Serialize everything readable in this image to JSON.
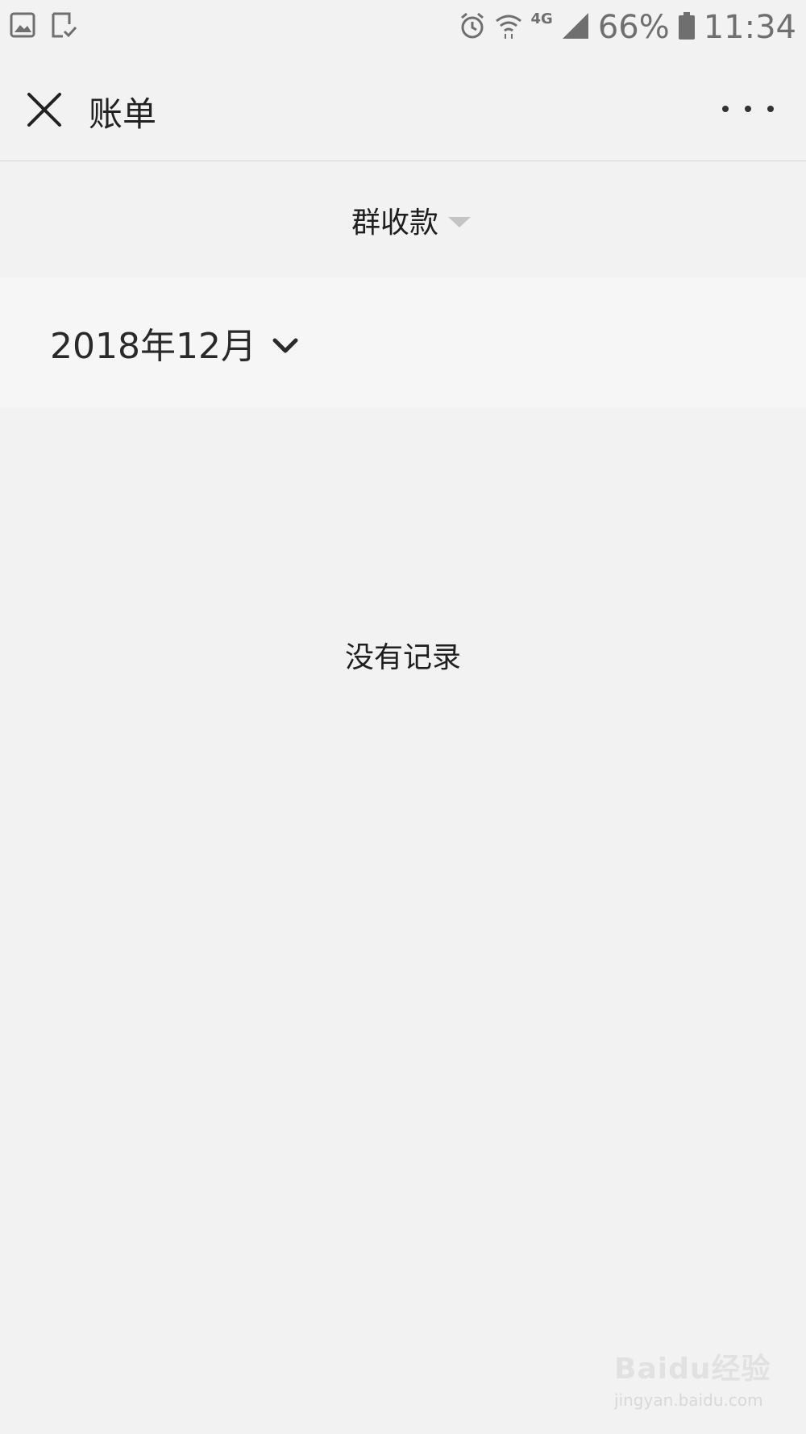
{
  "status_bar": {
    "battery_percent": "66%",
    "time": "11:34",
    "network": "4G",
    "icons": [
      "gallery-icon",
      "download-check-icon",
      "alarm-icon",
      "wifi-icon",
      "signal-icon",
      "battery-icon"
    ]
  },
  "header": {
    "title": "账单",
    "close_icon": "close-icon",
    "more_icon": "more-icon"
  },
  "filter": {
    "label": "群收款",
    "caret_icon": "caret-down-icon"
  },
  "month_selector": {
    "label": "2018年12月",
    "chevron_icon": "chevron-down-icon"
  },
  "empty_state": {
    "text": "没有记录"
  },
  "watermark": {
    "logo": "Baidu经验",
    "url": "jingyan.baidu.com"
  },
  "colors": {
    "background": "#f2f2f2",
    "month_row": "#f6f6f6",
    "text": "#1f1f1f",
    "caret": "#c4c4c4"
  }
}
